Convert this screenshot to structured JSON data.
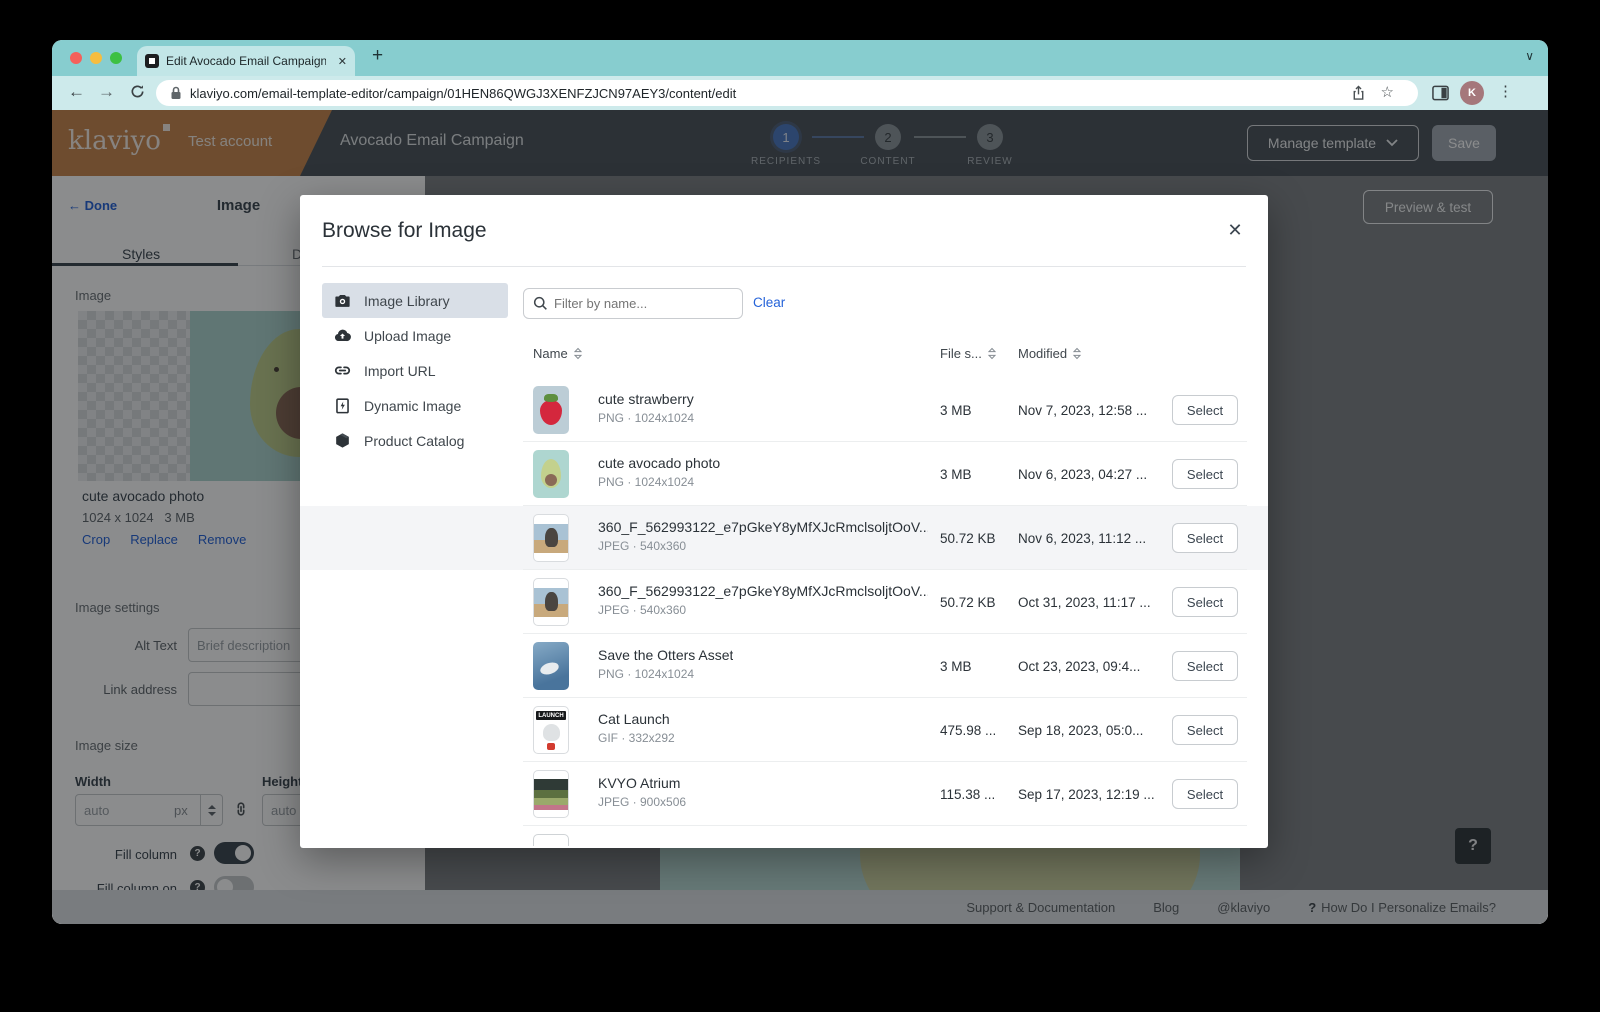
{
  "colors": {
    "chrome_teal": "#87cdcf",
    "accent_blue": "#2563d9",
    "header_dark": "#4c545b",
    "brand_orange": "#c8874f",
    "traffic_red": "#f4605b",
    "traffic_yellow": "#f6bd3f",
    "traffic_green": "#3dc043"
  },
  "browser": {
    "tab_title": "Edit Avocado Email Campaign",
    "url": "klaviyo.com/email-template-editor/campaign/01HEN86QWGJ3XENFZJCN97AEY3/content/edit",
    "avatar_initial": "K"
  },
  "icons": {
    "close": "✕",
    "new_tab": "+",
    "chevron_down": "∨",
    "back": "←",
    "forward": "→",
    "kebab": "⋮",
    "star": "☆",
    "help": "?"
  },
  "header": {
    "logo": "klaviyo",
    "account": "Test account",
    "campaign": "Avocado Email Campaign",
    "steps": [
      {
        "num": "1",
        "label": "RECIPIENTS"
      },
      {
        "num": "2",
        "label": "CONTENT"
      },
      {
        "num": "3",
        "label": "REVIEW"
      }
    ],
    "manage_template_label": "Manage template",
    "save_label": "Save"
  },
  "canvas": {
    "preview_test_label": "Preview & test"
  },
  "panel": {
    "done_label": "Done",
    "title": "Image",
    "tab_styles": "Styles",
    "tab_display": "Display",
    "section_image": "Image",
    "image_name": "cute avocado photo",
    "image_dims": "1024 x 1024",
    "image_filesize": "3 MB",
    "crop": "Crop",
    "replace": "Replace",
    "remove": "Remove",
    "section_settings": "Image settings",
    "alt_text_label": "Alt Text",
    "alt_text_placeholder": "Brief description",
    "link_label": "Link address",
    "section_size": "Image size",
    "width_label": "Width",
    "height_label": "Height",
    "width_value": "auto",
    "height_value": "auto",
    "px_suffix": "px",
    "fill_column_label": "Fill column",
    "fill_column_on_label": "Fill column on"
  },
  "modal": {
    "title": "Browse for Image",
    "nav": [
      {
        "label": "Image Library",
        "icon": "camera-icon"
      },
      {
        "label": "Upload Image",
        "icon": "cloud-upload-icon"
      },
      {
        "label": "Import URL",
        "icon": "link-icon"
      },
      {
        "label": "Dynamic Image",
        "icon": "dynamic-image-icon"
      },
      {
        "label": "Product Catalog",
        "icon": "cube-icon"
      }
    ],
    "filter_placeholder": "Filter by name...",
    "clear_label": "Clear",
    "columns": {
      "name": "Name",
      "size": "File s...",
      "modified": "Modified"
    },
    "select_label": "Select",
    "rows": [
      {
        "name": "cute strawberry",
        "meta": "PNG · 1024x1024",
        "size": "3 MB",
        "modified": "Nov 7, 2023, 12:58 ...",
        "thumb": "strawberry"
      },
      {
        "name": "cute avocado photo",
        "meta": "PNG · 1024x1024",
        "size": "3 MB",
        "modified": "Nov 6, 2023, 04:27 ...",
        "thumb": "avocado"
      },
      {
        "name": "360_F_562993122_e7pGkeY8yMfXJcRmclsoljtOoV...",
        "meta": "JPEG · 540x360",
        "size": "50.72 KB",
        "modified": "Nov 6, 2023, 11:12 ...",
        "thumb": "cat"
      },
      {
        "name": "360_F_562993122_e7pGkeY8yMfXJcRmclsoljtOoV...",
        "meta": "JPEG · 540x360",
        "size": "50.72 KB",
        "modified": "Oct 31, 2023, 11:17 ...",
        "thumb": "cat"
      },
      {
        "name": "Save the Otters Asset",
        "meta": "PNG · 1024x1024",
        "size": "3 MB",
        "modified": "Oct 23, 2023, 09:4...",
        "thumb": "otters"
      },
      {
        "name": "Cat Launch",
        "meta": "GIF · 332x292",
        "size": "475.98 ...",
        "modified": "Sep 18, 2023, 05:0...",
        "thumb": "launch",
        "thumb_text": "LAUNCH"
      },
      {
        "name": "KVYO Atrium",
        "meta": "JPEG · 900x506",
        "size": "115.38 ...",
        "modified": "Sep 17, 2023, 12:19 ...",
        "thumb": "atrium"
      }
    ]
  },
  "footer": {
    "links": [
      "Support & Documentation",
      "Blog",
      "@klaviyo"
    ],
    "help_prefix": "?",
    "help_link": "How Do I Personalize Emails?",
    "help_button": "?"
  }
}
